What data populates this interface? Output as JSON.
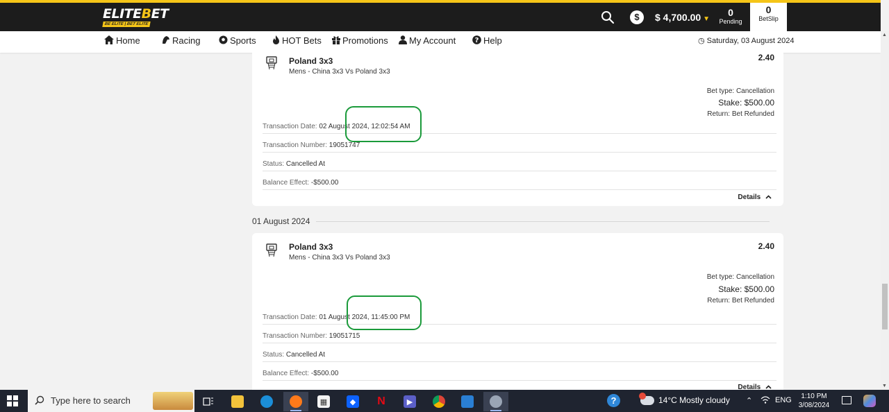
{
  "header": {
    "logo_text": "ELITEBET",
    "logo_tagline": "BE ELITE | BET ELITE",
    "balance": "$ 4,700.00",
    "pending_count": "0",
    "pending_label": "Pending",
    "betslip_count": "0",
    "betslip_label": "BetSlip"
  },
  "nav": {
    "items": [
      {
        "label": "Home",
        "icon": "home-icon"
      },
      {
        "label": "Racing",
        "icon": "racing-icon"
      },
      {
        "label": "Sports",
        "icon": "soccer-ball-icon"
      },
      {
        "label": "HOT Bets",
        "icon": "flame-icon"
      },
      {
        "label": "Promotions",
        "icon": "gift-icon"
      },
      {
        "label": "My Account",
        "icon": "user-icon"
      },
      {
        "label": "Help",
        "icon": "help-icon"
      }
    ],
    "date": "Saturday, 03 August 2024"
  },
  "transactions": [
    {
      "event": "Poland 3x3",
      "market": "Mens - China 3x3 Vs Poland 3x3",
      "odds": "2.40",
      "bet_type": "Bet type: Cancellation",
      "stake": "Stake: $500.00",
      "return": "Return: Bet Refunded",
      "date_label": "Transaction Date:",
      "date_value": "02 August 2024, 12:02:54 AM",
      "number_label": "Transaction Number:",
      "number_value": "19051747",
      "status_label": "Status:",
      "status_value": "Cancelled At",
      "balance_label": "Balance Effect:",
      "balance_value": "-$500.00",
      "details_label": "Details"
    },
    {
      "event": "Poland 3x3",
      "market": "Mens - China 3x3 Vs Poland 3x3",
      "odds": "2.40",
      "bet_type": "Bet type: Cancellation",
      "stake": "Stake: $500.00",
      "return": "Return: Bet Refunded",
      "date_label": "Transaction Date:",
      "date_value": "01 August 2024, 11:45:00 PM",
      "number_label": "Transaction Number:",
      "number_value": "19051715",
      "status_label": "Status:",
      "status_value": "Cancelled At",
      "balance_label": "Balance Effect:",
      "balance_value": "-$500.00",
      "details_label": "Details"
    }
  ],
  "day_header": "01 August 2024",
  "taskbar": {
    "search_placeholder": "Type here to search",
    "weather": "14°C  Mostly cloudy",
    "language": "ENG",
    "time": "1:10 PM",
    "date": "3/08/2024"
  },
  "colors": {
    "brand_yellow": "#f5c518",
    "header_bg": "#1c1c1c",
    "highlight_green": "#1a9a3a"
  }
}
